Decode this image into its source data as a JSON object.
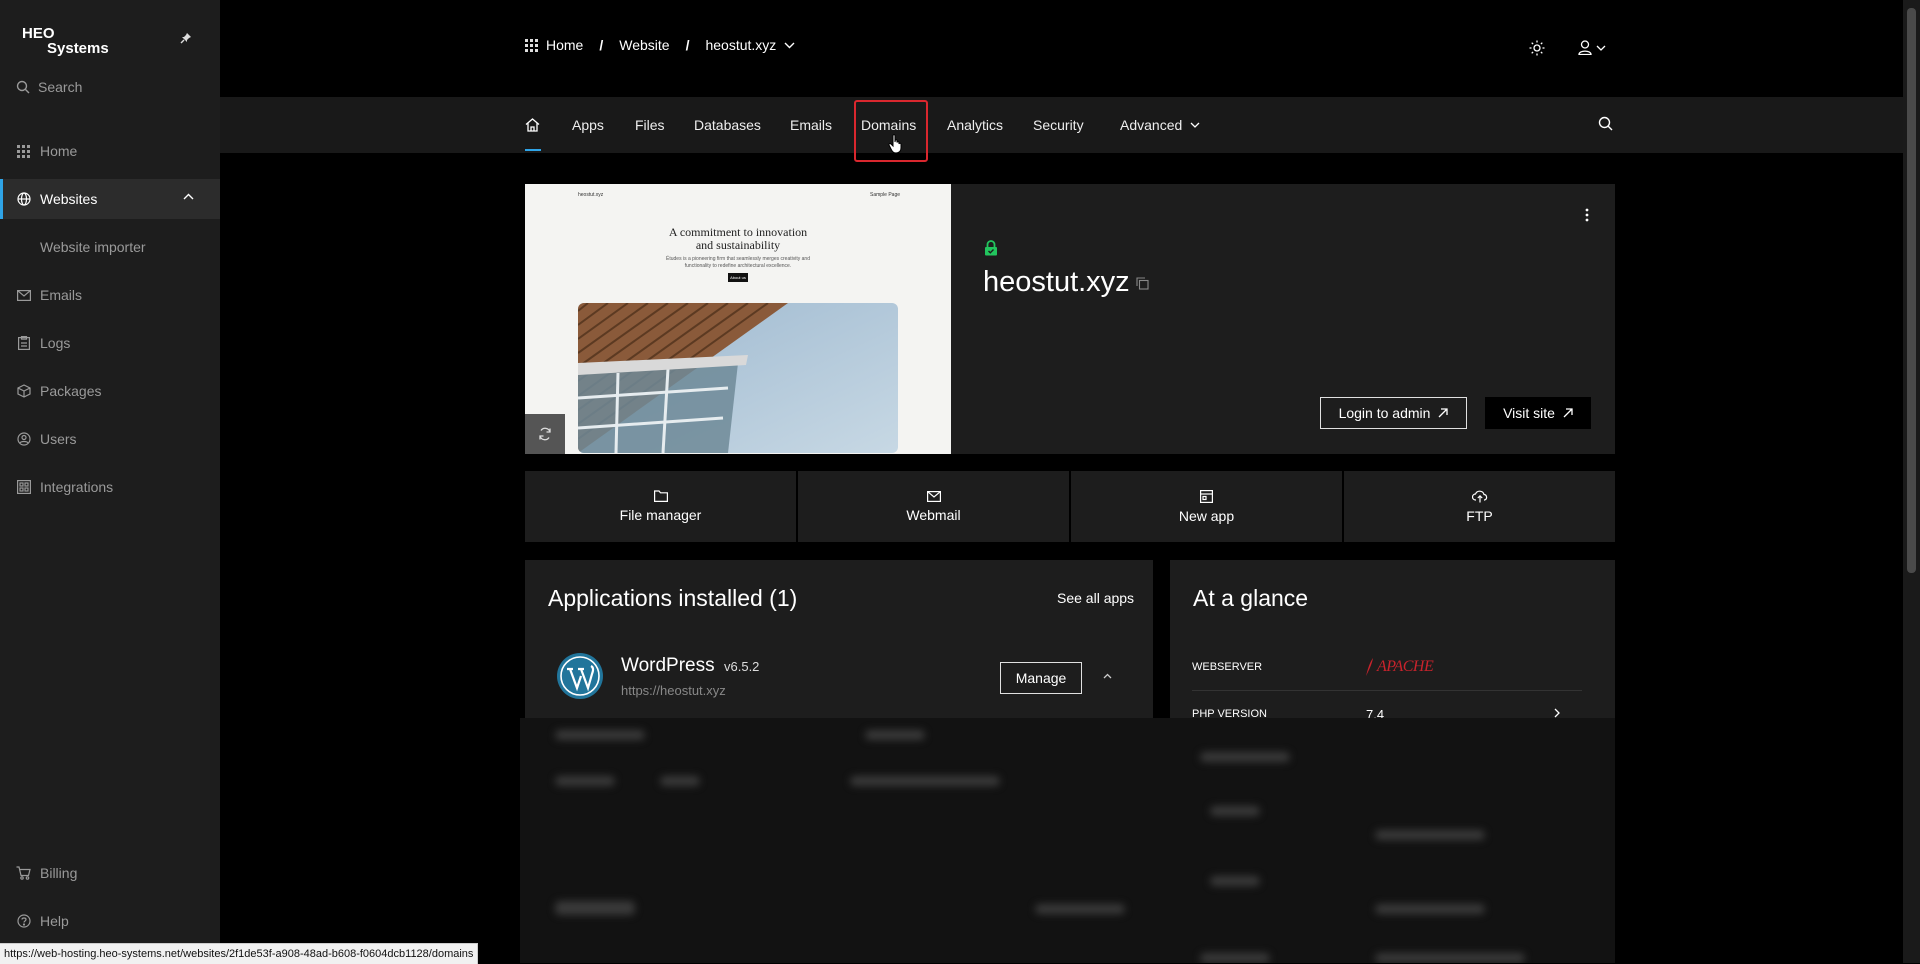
{
  "brand": {
    "line1": "HEO",
    "line2": "Systems"
  },
  "sidebar": {
    "search_label": "Search",
    "items": [
      {
        "label": "Home",
        "icon": "grid-icon"
      },
      {
        "label": "Websites",
        "icon": "globe-icon",
        "active": true
      },
      {
        "label": "Website importer"
      },
      {
        "label": "Emails",
        "icon": "mail-icon"
      },
      {
        "label": "Logs",
        "icon": "clipboard-icon"
      },
      {
        "label": "Packages",
        "icon": "package-icon"
      },
      {
        "label": "Users",
        "icon": "user-circle-icon"
      },
      {
        "label": "Integrations",
        "icon": "integrations-icon"
      }
    ],
    "bottom": [
      {
        "label": "Billing",
        "icon": "cart-icon"
      },
      {
        "label": "Help",
        "icon": "help-icon"
      }
    ]
  },
  "breadcrumb": {
    "items": [
      "Home",
      "Website",
      "heostut.xyz"
    ],
    "separator": "/"
  },
  "tabs": [
    "Apps",
    "Files",
    "Databases",
    "Emails",
    "Domains",
    "Analytics",
    "Security",
    "Advanced"
  ],
  "site": {
    "title": "heostut.xyz",
    "login_label": "Login to admin",
    "visit_label": "Visit site",
    "preview": {
      "site_name": "heostut.xyz",
      "nav_link": "Sample Page",
      "headline_1": "A commitment to innovation",
      "headline_2": "and sustainability",
      "body_1": "Études is a pioneering firm that seamlessly merges creativity and",
      "body_2": "functionality to redefine architectural excellence.",
      "button": "About us"
    }
  },
  "quick_actions": [
    {
      "label": "File manager",
      "icon": "folder-icon"
    },
    {
      "label": "Webmail",
      "icon": "mail-icon"
    },
    {
      "label": "New app",
      "icon": "app-icon"
    },
    {
      "label": "FTP",
      "icon": "cloud-upload-icon"
    }
  ],
  "apps_panel": {
    "title": "Applications installed (1)",
    "see_all": "See all apps",
    "app": {
      "name": "WordPress",
      "version": "v6.5.2",
      "url": "https://heostut.xyz",
      "manage_label": "Manage"
    }
  },
  "glance": {
    "title": "At a glance",
    "rows": [
      {
        "key": "WEBSERVER",
        "value": "APACHE"
      },
      {
        "key": "PHP VERSION",
        "value": "7.4"
      }
    ]
  },
  "status_url": "https://web-hosting.heo-systems.net/websites/2f1de53f-a908-48ad-b608-f0604dcb1128/domains",
  "colors": {
    "accent": "#2fa4e7",
    "highlight": "#d9272e",
    "lock": "#22c55e",
    "apache": "#c8232c"
  }
}
